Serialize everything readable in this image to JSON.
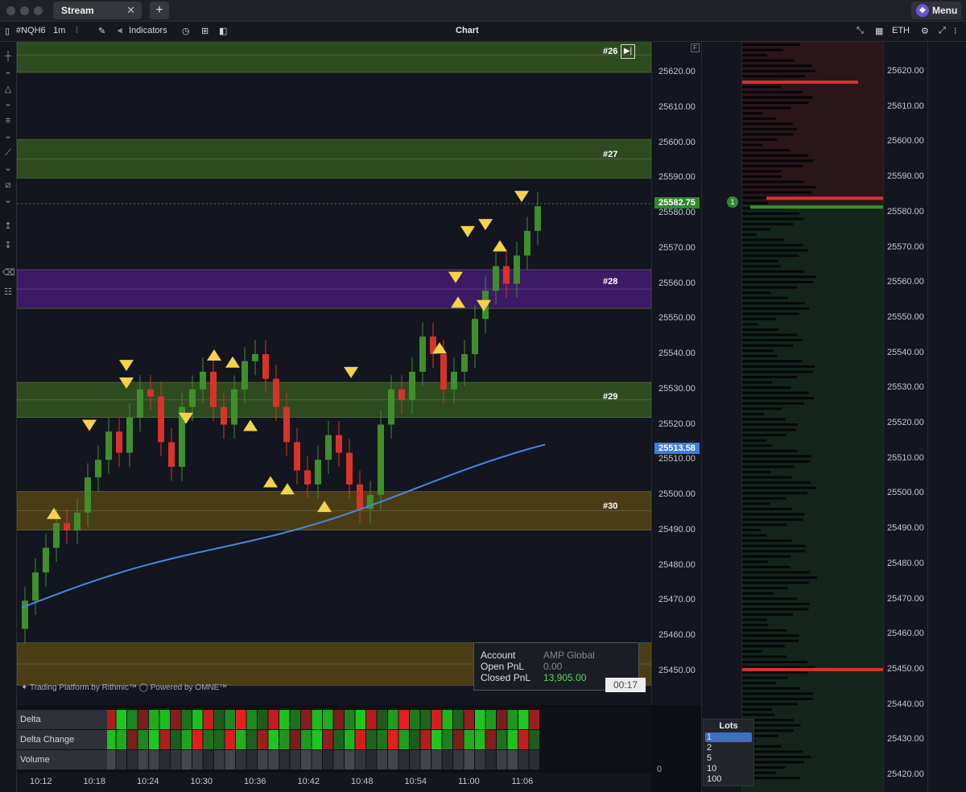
{
  "window": {
    "tab_label": "Stream",
    "tab_close": "✕",
    "new_tab": "+",
    "menu_label": "Menu"
  },
  "toolbar": {
    "symbol": "#NQH6",
    "interval": "1m",
    "indicators_label": "Indicators",
    "title": "Chart",
    "session": "ETH"
  },
  "price_axis": {
    "labels": [
      "25620.00",
      "25610.00",
      "25600.00",
      "25590.00",
      "25580.00",
      "25570.00",
      "25560.00",
      "25550.00",
      "25540.00",
      "25530.00",
      "25520.00",
      "25510.00",
      "25500.00",
      "25490.00",
      "25480.00",
      "25470.00",
      "25460.00",
      "25450.00"
    ],
    "current_price": "25582.75",
    "ma_price": "25513.58",
    "f_marker": "F"
  },
  "zones": [
    {
      "label": "#26",
      "color": "#2e4a1f",
      "range": [
        25620,
        25630
      ]
    },
    {
      "label": "#27",
      "color": "#2e4a1f",
      "range": [
        25590,
        25601
      ]
    },
    {
      "label": "#28",
      "color": "#3c1a66",
      "range": [
        25553,
        25564
      ]
    },
    {
      "label": "#29",
      "color": "#2e4a1f",
      "range": [
        25522,
        25532
      ]
    },
    {
      "label": "#30",
      "color": "#4a3d16",
      "range": [
        25490,
        25501
      ]
    },
    {
      "label": "",
      "color": "#4a3d16",
      "range": [
        25446,
        25458
      ]
    }
  ],
  "branding": {
    "text": "✦ Trading Platform by Rithmic™  ◯ Powered by OMNE™"
  },
  "pnl": {
    "account_key": "Account",
    "account_val": "AMP Global",
    "open_key": "Open PnL",
    "open_val": "0.00",
    "closed_key": "Closed PnL",
    "closed_val": "13,905.00",
    "timer": "00:17"
  },
  "indicators": {
    "labels": [
      "Delta",
      "Delta Change",
      "Volume"
    ],
    "zero_label": "0"
  },
  "time_axis": {
    "labels": [
      "10:12",
      "10:18",
      "10:24",
      "10:30",
      "10:36",
      "10:42",
      "10:48",
      "10:54",
      "11:00",
      "11:06"
    ]
  },
  "dom": {
    "price_labels": [
      "25620.00",
      "25610.00",
      "25600.00",
      "25590.00",
      "25580.00",
      "25570.00",
      "25560.00",
      "25550.00",
      "25540.00",
      "25530.00",
      "25520.00",
      "25510.00",
      "25500.00",
      "25490.00",
      "25480.00",
      "25470.00",
      "25460.00",
      "25450.00",
      "25440.00",
      "25430.00",
      "25420.00"
    ],
    "position_badge": "1",
    "lots_title": "Lots",
    "lots_options": [
      "1",
      "2",
      "5",
      "10",
      "100"
    ],
    "lots_selected": "1"
  },
  "colors": {
    "up": "#3f8f2c",
    "down": "#d8332a",
    "signal": "#f4d24a",
    "ma": "#4a86e0"
  }
}
